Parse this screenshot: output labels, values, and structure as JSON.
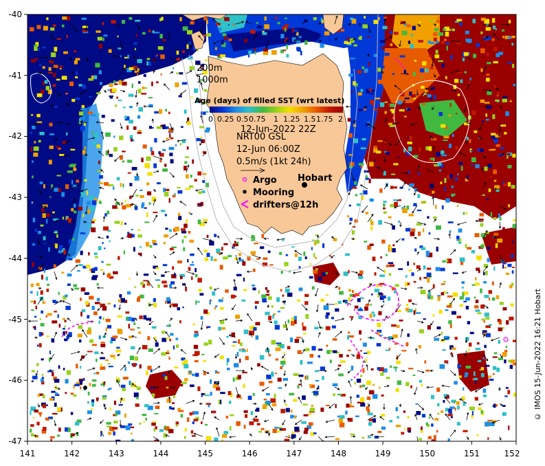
{
  "map": {
    "lon_ticks": [
      "141",
      "142",
      "143",
      "144",
      "145",
      "146",
      "147",
      "148",
      "149",
      "150",
      "151",
      "152"
    ],
    "lat_ticks": [
      "-40",
      "-41",
      "-42",
      "-43",
      "-44",
      "-45",
      "-46",
      "-47"
    ],
    "lon_range": [
      141,
      152
    ],
    "lat_range": [
      -47,
      -40
    ],
    "contour_labels": [
      "200m",
      "1000m"
    ],
    "place_label": "Hobart",
    "colors": {
      "land": "#f9c898",
      "ocean_bg": "#ffffff",
      "contour": "#b8b8b8",
      "argo": "#ff00ff",
      "mooring": "#000000",
      "drifter": "#ff00ff"
    }
  },
  "colorbar": {
    "title": "Age (days) of filled SST (wrt latest)",
    "tick_labels": [
      "0",
      "0.25",
      "0.5",
      "0.75",
      "1",
      "1.25",
      "1.5",
      "1.75",
      "2"
    ],
    "colors": [
      "#000a84",
      "#0038d8",
      "#1d8ee8",
      "#2fc0c8",
      "#41b941",
      "#98d21b",
      "#f3e000",
      "#f0a000",
      "#e85a00",
      "#c01800",
      "#9a0000"
    ]
  },
  "info": {
    "sst_time": "12-Jun-2022 22Z",
    "current_product": "NRT00 GSL",
    "current_time": "12-Jun 06:00Z",
    "vector_scale": "0.5m/s (1kt 24h)"
  },
  "legend": {
    "argo": "Argo",
    "mooring": "Mooring",
    "drifters": "drifters@12h"
  },
  "credit": "© IMOS 15-Jun-2022 16:21 Hobart"
}
